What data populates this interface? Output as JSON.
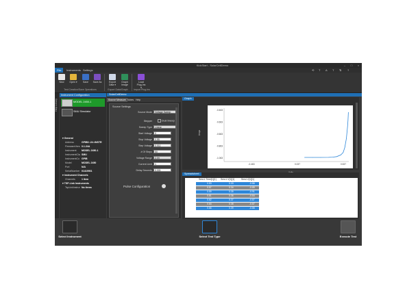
{
  "window": {
    "title": "KickStart - SolarCellDemo"
  },
  "status_readout": "00 : 00 : 00",
  "menu": {
    "items": [
      "File",
      "Instruments",
      "Settings"
    ]
  },
  "ribbon": {
    "buttons": [
      {
        "label": "New",
        "icon": "new-file-icon"
      },
      {
        "label": "Open ▾",
        "icon": "open-folder-icon"
      },
      {
        "label": "Save",
        "icon": "save-icon"
      },
      {
        "label": "Save As",
        "icon": "save-as-icon"
      },
      {
        "label": "Export Data ▾",
        "icon": "export-data-icon"
      },
      {
        "label": "Graph Image",
        "icon": "graph-image-icon"
      },
      {
        "label": "Load Plug-Ins ▾",
        "icon": "plugin-icon"
      }
    ],
    "groups": [
      "Test Creation/Save Operations",
      "Export Data/Graph",
      "Import Plug-Ins"
    ]
  },
  "sidebar_strip_label": "Help Library",
  "instrument_panel": {
    "header": "Instrument Configuration",
    "instruments": [
      {
        "name": "MODEL 2450-1",
        "selected": true
      },
      {
        "name": "SMU Simulator",
        "selected": false
      }
    ],
    "general_header": "General",
    "properties": [
      {
        "key": "Address",
        "value": "GPIB0::24::INSTR"
      },
      {
        "key": "FirmwareVers",
        "value": "0.1.24A"
      },
      {
        "key": "Instrument",
        "value": "MODEL 2450-1"
      },
      {
        "key": "InstrumentCla",
        "value": "SMU"
      },
      {
        "key": "InstrumentCo",
        "value": "GPIB"
      },
      {
        "key": "Model",
        "value": "MODEL 2450"
      },
      {
        "key": "Port",
        "value": "N/A"
      },
      {
        "key": "SerialNumber",
        "value": "01419901"
      }
    ],
    "channels_header": "Instrument Channels",
    "channels": {
      "key": "Channels",
      "value": "1 item"
    },
    "tsp_header": "TSP-Link Instruments",
    "tsp": {
      "key": "TspLinkInstrur",
      "value": "No items"
    }
  },
  "main_tab": "SolarCellDemo",
  "subtabs": [
    "Source Measure",
    "Notes",
    "Help"
  ],
  "settings": {
    "header": "Source Settings",
    "source_mode_label": "Source Mode",
    "source_mode": "Voltage Sweep",
    "stepper_label": "Stepper",
    "dual_sweep_label": "Dual Sweep",
    "sweep_type_label": "Sweep Type",
    "sweep_type": "Linear",
    "start_voltage_label": "Start Voltage",
    "start_voltage": "0",
    "stop_voltage_label": "Stop Voltage",
    "stop_voltage": "0.55",
    "step_voltage_label": "Step Voltage",
    "step_voltage": "0.011",
    "steps_label": "# Of Steps",
    "steps": "50",
    "voltage_range_label": "Voltage Range",
    "voltage_range": "2.0V",
    "current_limit_label": "Current Limit",
    "current_limit": "1",
    "delay_label": "Delay Seconds",
    "delay": "0.001",
    "pulse_label": "Pulse Configuration"
  },
  "graph": {
    "tab": "Graph",
    "ylabel": "Amps",
    "xlabel": "Volts"
  },
  "chart_data": {
    "type": "line",
    "x": [
      0,
      0.1,
      0.2,
      0.3,
      0.35,
      0.4,
      0.45,
      0.48,
      0.5,
      0.52,
      0.535,
      0.54,
      0.545
    ],
    "y": [
      -1.0,
      -1.0,
      -1.0,
      -0.999,
      -0.997,
      -0.99,
      -0.97,
      -0.94,
      -0.88,
      -0.77,
      -0.62,
      -0.55,
      -0.45
    ],
    "yticks": [
      "-0.463",
      "-0.663",
      "-0.663",
      "-0.863",
      "-1.063"
    ],
    "xticks": [
      "-0.463",
      "0.037",
      "0.537"
    ],
    "xlim": [
      -1,
      0.55
    ],
    "ylim": [
      -1.05,
      -0.4
    ],
    "color": "#2e87d9",
    "xlabel": "Volts",
    "ylabel": "Amps"
  },
  "spreadsheet": {
    "tab": "Spreadsheet",
    "headers": [
      "Smu1.Time[1][1]",
      "Smu1.V[1][1]",
      "Smu1.I[1][1]"
    ],
    "rows": [
      [
        "0.53",
        "0.33",
        "-0.86"
      ],
      [
        "0.57",
        "0.34",
        "-0.89"
      ],
      [
        "0.59",
        "0.35",
        "-0.91"
      ],
      [
        "0.61",
        "0.36",
        "-0.84"
      ],
      [
        "0.62",
        "0.37",
        "-0.87"
      ],
      [
        "0.64",
        "0.38",
        "-0.87"
      ],
      [
        "0.66",
        "0.39",
        "-0.86"
      ]
    ]
  },
  "bottom": {
    "select_instrument": "Select Instrument",
    "select_test_type": "Select Test Type",
    "execute_test": "Execute Test"
  }
}
